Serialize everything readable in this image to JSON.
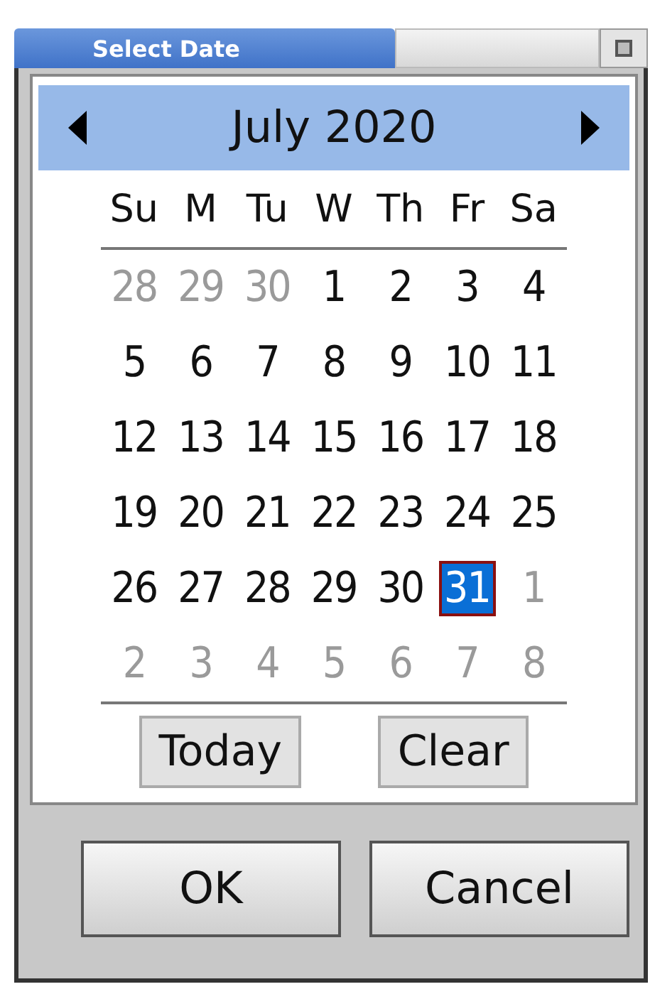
{
  "window": {
    "title": "Select Date"
  },
  "calendar": {
    "month": "July 2020",
    "weekdays": [
      "Su",
      "M",
      "Tu",
      "W",
      "Th",
      "Fr",
      "Sa"
    ],
    "weeks": [
      [
        {
          "label": "28",
          "muted": true,
          "selected": false
        },
        {
          "label": "29",
          "muted": true,
          "selected": false
        },
        {
          "label": "30",
          "muted": true,
          "selected": false
        },
        {
          "label": "1",
          "muted": false,
          "selected": false
        },
        {
          "label": "2",
          "muted": false,
          "selected": false
        },
        {
          "label": "3",
          "muted": false,
          "selected": false
        },
        {
          "label": "4",
          "muted": false,
          "selected": false
        }
      ],
      [
        {
          "label": "5",
          "muted": false,
          "selected": false
        },
        {
          "label": "6",
          "muted": false,
          "selected": false
        },
        {
          "label": "7",
          "muted": false,
          "selected": false
        },
        {
          "label": "8",
          "muted": false,
          "selected": false
        },
        {
          "label": "9",
          "muted": false,
          "selected": false
        },
        {
          "label": "10",
          "muted": false,
          "selected": false
        },
        {
          "label": "11",
          "muted": false,
          "selected": false
        }
      ],
      [
        {
          "label": "12",
          "muted": false,
          "selected": false
        },
        {
          "label": "13",
          "muted": false,
          "selected": false
        },
        {
          "label": "14",
          "muted": false,
          "selected": false
        },
        {
          "label": "15",
          "muted": false,
          "selected": false
        },
        {
          "label": "16",
          "muted": false,
          "selected": false
        },
        {
          "label": "17",
          "muted": false,
          "selected": false
        },
        {
          "label": "18",
          "muted": false,
          "selected": false
        }
      ],
      [
        {
          "label": "19",
          "muted": false,
          "selected": false
        },
        {
          "label": "20",
          "muted": false,
          "selected": false
        },
        {
          "label": "21",
          "muted": false,
          "selected": false
        },
        {
          "label": "22",
          "muted": false,
          "selected": false
        },
        {
          "label": "23",
          "muted": false,
          "selected": false
        },
        {
          "label": "24",
          "muted": false,
          "selected": false
        },
        {
          "label": "25",
          "muted": false,
          "selected": false
        }
      ],
      [
        {
          "label": "26",
          "muted": false,
          "selected": false
        },
        {
          "label": "27",
          "muted": false,
          "selected": false
        },
        {
          "label": "28",
          "muted": false,
          "selected": false
        },
        {
          "label": "29",
          "muted": false,
          "selected": false
        },
        {
          "label": "30",
          "muted": false,
          "selected": false
        },
        {
          "label": "31",
          "muted": false,
          "selected": true
        },
        {
          "label": "1",
          "muted": true,
          "selected": false
        }
      ],
      [
        {
          "label": "2",
          "muted": true,
          "selected": false
        },
        {
          "label": "3",
          "muted": true,
          "selected": false
        },
        {
          "label": "4",
          "muted": true,
          "selected": false
        },
        {
          "label": "5",
          "muted": true,
          "selected": false
        },
        {
          "label": "6",
          "muted": true,
          "selected": false
        },
        {
          "label": "7",
          "muted": true,
          "selected": false
        },
        {
          "label": "8",
          "muted": true,
          "selected": false
        }
      ]
    ],
    "actions": [
      "Today",
      "Clear"
    ]
  },
  "buttons": [
    "OK",
    "Cancel"
  ]
}
